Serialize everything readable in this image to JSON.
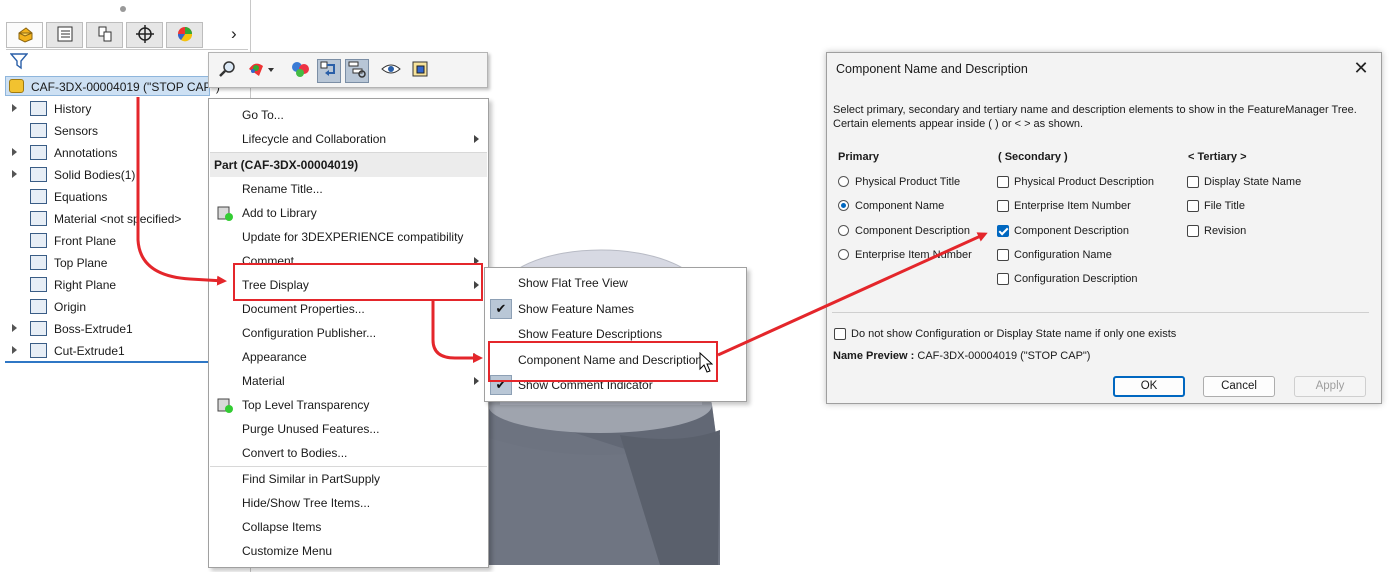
{
  "feature_manager": {
    "tabs": [
      "featuremanager-icon",
      "propertymanager-icon",
      "configurationmanager-icon",
      "dimxpert-icon",
      "display-manager-icon"
    ],
    "root_label": "CAF-3DX-00004019 (\"STOP CAP\")",
    "tree_items": [
      {
        "label": "History",
        "icon": "history-icon",
        "expandable": true
      },
      {
        "label": "Sensors",
        "icon": "sensors-icon",
        "expandable": false
      },
      {
        "label": "Annotations",
        "icon": "annotations-icon",
        "expandable": true
      },
      {
        "label": "Solid Bodies(1)",
        "icon": "solid-bodies-icon",
        "expandable": true
      },
      {
        "label": "Equations",
        "icon": "equations-icon",
        "expandable": false
      },
      {
        "label": "Material <not specified>",
        "icon": "material-icon",
        "expandable": false
      },
      {
        "label": "Front Plane",
        "icon": "plane-icon",
        "expandable": false
      },
      {
        "label": "Top Plane",
        "icon": "plane-icon",
        "expandable": false
      },
      {
        "label": "Right Plane",
        "icon": "plane-icon",
        "expandable": false
      },
      {
        "label": "Origin",
        "icon": "origin-icon",
        "expandable": false
      },
      {
        "label": "Boss-Extrude1",
        "icon": "boss-extrude-icon",
        "expandable": true
      },
      {
        "label": "Cut-Extrude1",
        "icon": "cut-extrude-icon",
        "expandable": true
      }
    ]
  },
  "context_menu": {
    "items": [
      {
        "label": "Go To...",
        "type": "item"
      },
      {
        "label": "Lifecycle and Collaboration",
        "type": "submenu"
      },
      {
        "label": "Part (CAF-3DX-00004019)",
        "type": "header"
      },
      {
        "label": "Rename Title...",
        "type": "item"
      },
      {
        "label": "Add to Library",
        "type": "item"
      },
      {
        "label": "Update for 3DEXPERIENCE compatibility",
        "type": "item"
      },
      {
        "label": "Comment",
        "type": "submenu"
      },
      {
        "label": "Tree Display",
        "type": "submenu"
      },
      {
        "label": "Document Properties...",
        "type": "item"
      },
      {
        "label": "Configuration Publisher...",
        "type": "item"
      },
      {
        "label": "Appearance",
        "type": "submenu"
      },
      {
        "label": "Material",
        "type": "submenu"
      },
      {
        "label": "Top Level Transparency",
        "type": "item"
      },
      {
        "label": "Purge Unused Features...",
        "type": "item"
      },
      {
        "label": "Convert to Bodies...",
        "type": "item"
      },
      {
        "label": "Find Similar in PartSupply",
        "type": "item"
      },
      {
        "label": "Hide/Show Tree Items...",
        "type": "item"
      },
      {
        "label": "Collapse Items",
        "type": "item"
      },
      {
        "label": "Customize Menu",
        "type": "item"
      }
    ]
  },
  "tree_display_submenu": {
    "items": [
      {
        "label": "Show Flat Tree View",
        "checked": false
      },
      {
        "label": "Show Feature Names",
        "checked": true
      },
      {
        "label": "Show Feature Descriptions",
        "checked": false
      },
      {
        "label": "Component Name and Description...",
        "checked": false
      },
      {
        "label": "Show Comment Indicator",
        "checked": true
      }
    ]
  },
  "dialog": {
    "title": "Component Name and Description",
    "description": "Select primary, secondary and tertiary name and description elements to show in the FeatureManager Tree. Certain elements appear inside ( ) or < > as shown.",
    "primary": {
      "heading": "Primary",
      "options": [
        {
          "label": "Physical Product Title",
          "selected": false
        },
        {
          "label": "Component Name",
          "selected": true
        },
        {
          "label": "Component Description",
          "selected": false
        },
        {
          "label": "Enterprise Item Number",
          "selected": false
        }
      ]
    },
    "secondary": {
      "heading": "( Secondary )",
      "options": [
        {
          "label": "Physical Product Description",
          "checked": false
        },
        {
          "label": "Enterprise Item Number",
          "checked": false
        },
        {
          "label": "Component Description",
          "checked": true
        },
        {
          "label": "Configuration Name",
          "checked": false
        },
        {
          "label": "Configuration Description",
          "checked": false
        }
      ]
    },
    "tertiary": {
      "heading": "< Tertiary >",
      "options": [
        {
          "label": "Display State Name",
          "checked": false
        },
        {
          "label": "File Title",
          "checked": false
        },
        {
          "label": "Revision",
          "checked": false
        }
      ]
    },
    "single_config_option": {
      "label": "Do not show Configuration or Display State name if only one exists",
      "checked": false
    },
    "preview_label": "Name Preview :",
    "preview_value": "CAF-3DX-00004019 (\"STOP CAP\")",
    "buttons": {
      "ok": "OK",
      "cancel": "Cancel",
      "apply": "Apply"
    }
  },
  "colors": {
    "highlight": "#e4262b",
    "selection": "#cde0f3",
    "accent": "#0067c0"
  }
}
